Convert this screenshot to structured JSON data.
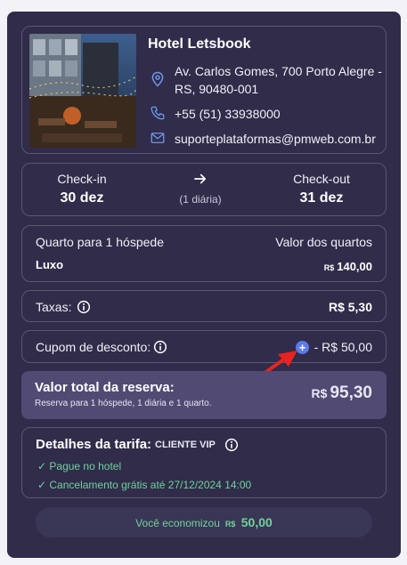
{
  "hotel": {
    "name": "Hotel Letsbook",
    "address": "Av. Carlos Gomes, 700 Porto Alegre - RS, 90480-001",
    "phone": "+55 (51) 33938000",
    "email": "suporteplataformas@pmweb.com.br"
  },
  "stay": {
    "checkin_label": "Check-in",
    "checkin_date": "30 dez",
    "nights": "(1 diária)",
    "checkout_label": "Check-out",
    "checkout_date": "31 dez"
  },
  "room": {
    "occupancy": "Quarto para 1 hóspede",
    "rooms_value_label": "Valor dos quartos",
    "type": "Luxo",
    "currency": "R$",
    "price": "140,00"
  },
  "taxes": {
    "label": "Taxas:",
    "value": "R$ 5,30"
  },
  "coupon": {
    "label": "Cupom de desconto:",
    "value": "- R$ 50,00"
  },
  "total": {
    "title": "Valor total da reserva:",
    "subtitle": "Reserva para 1 hóspede, 1 diária  e 1 quarto.",
    "currency": "R$",
    "value": "95,30"
  },
  "tariff": {
    "title": "Detalhes da tarifa:",
    "tag": "CLIENTE VIP",
    "perks": [
      "Pague no hotel",
      "Cancelamento grátis até 27/12/2024 14:00"
    ]
  },
  "savings": {
    "label": "Você economizou",
    "currency": "R$",
    "value": "50,00"
  },
  "colors": {
    "panel": "#302c4a",
    "accent_blue": "#5b7be8",
    "success_green": "#6fd39a",
    "annotation_red": "#e8231f"
  }
}
